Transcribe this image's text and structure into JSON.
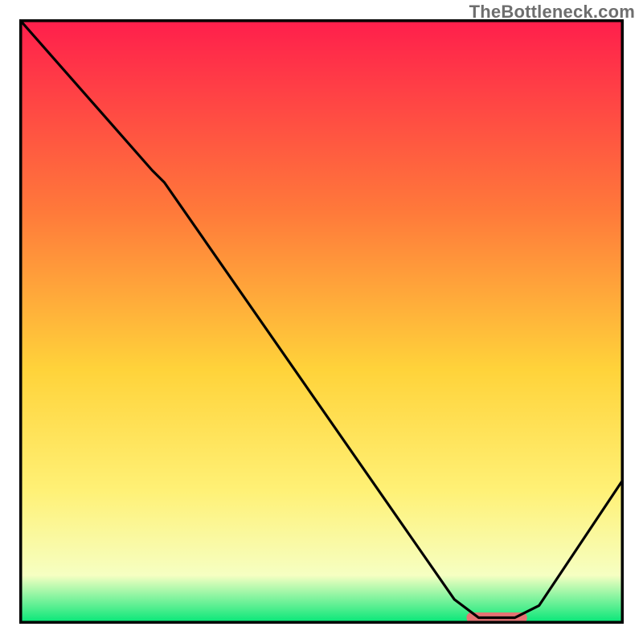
{
  "watermark": "TheBottleneck.com",
  "gradient": {
    "top": "#ff1e4c",
    "mid1": "#ff7a3a",
    "mid2": "#ffd33a",
    "mid3": "#fff176",
    "mid4": "#f6ffc2",
    "bottom": "#00e676"
  },
  "marker_color": "#e57373",
  "chart_data": {
    "type": "line",
    "title": "",
    "xlabel": "",
    "ylabel": "",
    "xlim": [
      0,
      100
    ],
    "ylim": [
      0,
      100
    ],
    "grid": false,
    "legend": false,
    "series": [
      {
        "name": "curve",
        "x": [
          0,
          22,
          24,
          72,
          76,
          82,
          86,
          100
        ],
        "values": [
          100,
          75,
          73,
          4,
          1,
          1,
          3,
          24
        ]
      }
    ],
    "optimum_band": {
      "x_start": 74,
      "x_end": 84,
      "y": 1
    }
  }
}
